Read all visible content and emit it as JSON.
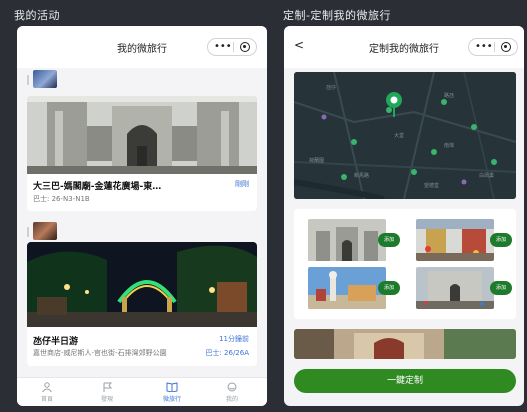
{
  "panels": {
    "left_label": "我的活动",
    "right_label": "定制-定制我的微旅行"
  },
  "left": {
    "header_title": "我的微旅行",
    "capsule_dots": "•••",
    "cards": [
      {
        "title": "大三巴-媽閣廟-金蓮花廣場-東…",
        "subtitle": "巴士: 26-N3-N1B",
        "right_text": "剛剛"
      },
      {
        "title": "氹仔半日游",
        "subtitle": "嘉世商店-威尼斯人-官也街-石排灣郊野公園",
        "right_time": "11分鐘前",
        "right_bus": "巴士: 26/26A"
      }
    ],
    "tabs": [
      {
        "label": "首頁",
        "icon": "home-icon"
      },
      {
        "label": "發現",
        "icon": "flag-icon"
      },
      {
        "label": "微旅行",
        "icon": "book-icon"
      },
      {
        "label": "我的",
        "icon": "profile-icon"
      }
    ],
    "active_tab": 2
  },
  "right": {
    "back": "<",
    "header_title": "定制我的微旅行",
    "capsule_dots": "•••",
    "add_label": "添加",
    "map_labels": [
      "氹仔",
      "路氹",
      "大堂",
      "南灣",
      "新馬路",
      "望德堂",
      "荷蘭園",
      "白鴿巢"
    ],
    "cta": "一鍵定制"
  },
  "colors": {
    "accent_blue": "#3f73d8",
    "cta_green": "#2f8a22",
    "add_green": "#1e7b2b",
    "map_pin": "#1fa85a"
  }
}
